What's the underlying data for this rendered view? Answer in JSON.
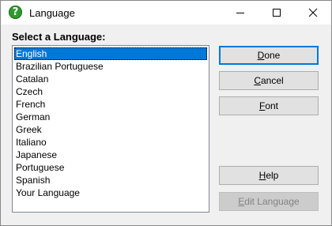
{
  "window": {
    "title": "Language",
    "app_icon_glyph": "?",
    "app_icon_color": "#2f9b2f"
  },
  "content": {
    "label": "Select a Language:",
    "languages": [
      "English",
      "Brazilian Portuguese",
      "Catalan",
      "Czech",
      "French",
      "German",
      "Greek",
      "Italiano",
      "Japanese",
      "Portuguese",
      "Spanish",
      "Your Language"
    ],
    "selected_language": "English",
    "selection_color": "#0078d7"
  },
  "buttons": {
    "done": {
      "mnemonic": "D",
      "rest": "one"
    },
    "cancel": {
      "mnemonic": "C",
      "rest": "ancel"
    },
    "font": {
      "mnemonic": "F",
      "rest": "ont"
    },
    "help": {
      "mnemonic": "H",
      "rest": "elp"
    },
    "edit_language": {
      "mnemonic": "E",
      "rest": "dit Language"
    }
  },
  "icons": {
    "minimize": "minimize-icon",
    "maximize": "maximize-icon",
    "close": "close-icon"
  }
}
